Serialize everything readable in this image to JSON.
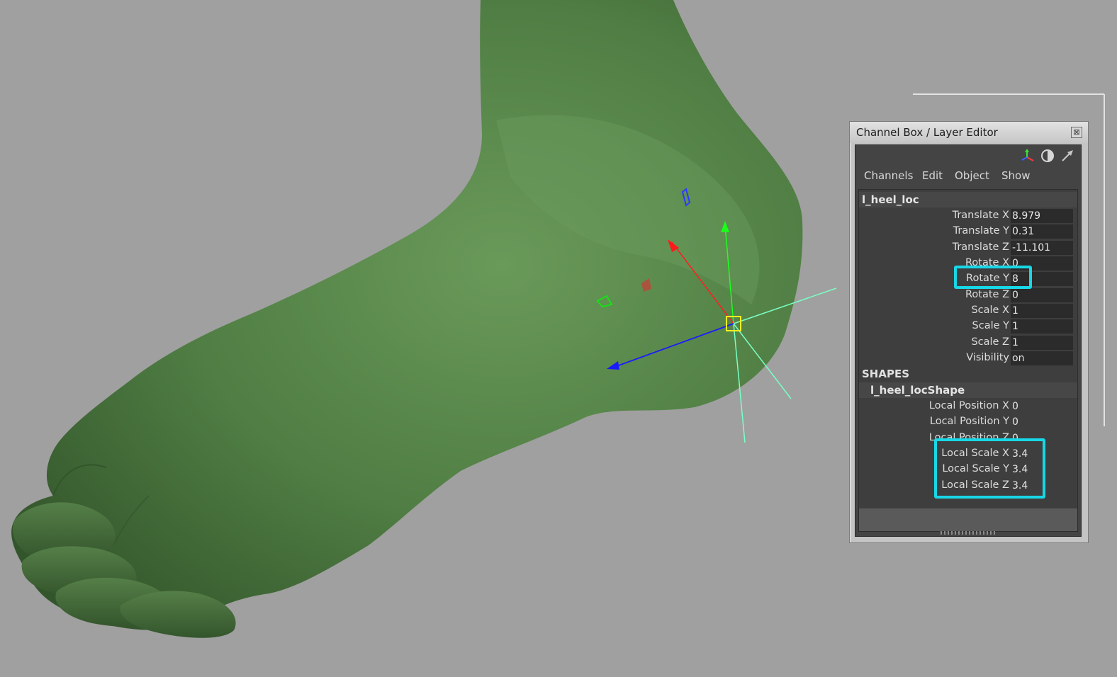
{
  "window": {
    "title": "Channel Box / Layer Editor",
    "close_glyph": "⊠"
  },
  "toolbar": {
    "icons": [
      "axis-icon",
      "half-circle-icon",
      "arrow-icon"
    ]
  },
  "menu": [
    "Channels",
    "Edit",
    "Object",
    "Show"
  ],
  "node": {
    "name": "l_heel_loc",
    "attributes": [
      {
        "label": "Translate X",
        "value": "8.979"
      },
      {
        "label": "Translate Y",
        "value": "0.31"
      },
      {
        "label": "Translate Z",
        "value": "-11.101"
      },
      {
        "label": "Rotate X",
        "value": "0"
      },
      {
        "label": "Rotate Y",
        "value": "8"
      },
      {
        "label": "Rotate Z",
        "value": "0"
      },
      {
        "label": "Scale X",
        "value": "1"
      },
      {
        "label": "Scale Y",
        "value": "1"
      },
      {
        "label": "Scale Z",
        "value": "1"
      },
      {
        "label": "Visibility",
        "value": "on"
      }
    ]
  },
  "shapes": {
    "header": "SHAPES",
    "name": "l_heel_locShape",
    "attributes": [
      {
        "label": "Local Position X",
        "value": "0"
      },
      {
        "label": "Local Position Y",
        "value": "0"
      },
      {
        "label": "Local Position Z",
        "value": "0"
      },
      {
        "label": "Local Scale X",
        "value": "3.4"
      },
      {
        "label": "Local Scale Y",
        "value": "3.4"
      },
      {
        "label": "Local Scale Z",
        "value": "3.4"
      }
    ]
  },
  "colors": {
    "viewport_bg": "#a0a0a0",
    "mesh_green": "#5a8a4c",
    "highlight": "#18d7e6",
    "axis_x": "#ff2020",
    "axis_y": "#20ff20",
    "axis_z": "#1a1aff",
    "locator": "#7affc4"
  }
}
